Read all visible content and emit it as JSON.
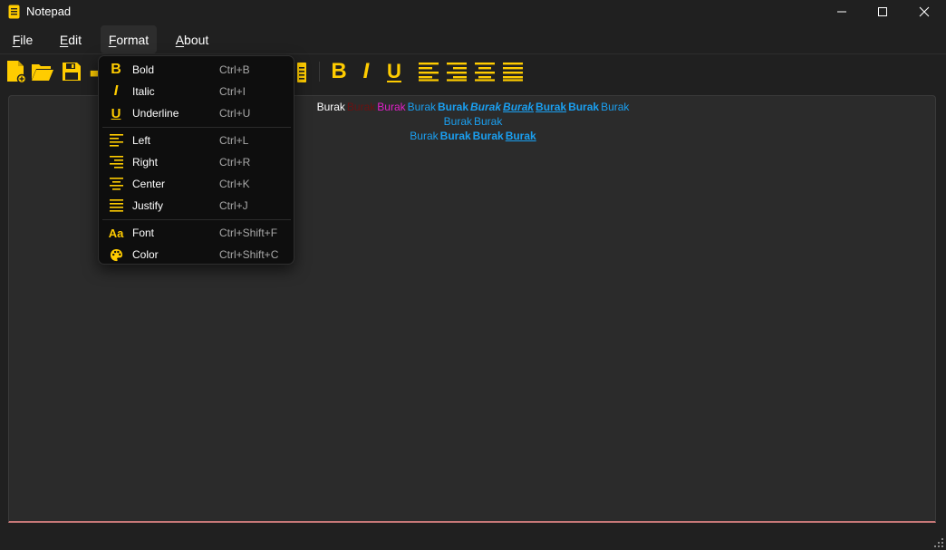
{
  "window": {
    "title": "Notepad"
  },
  "menubar": {
    "file": {
      "mnemonic": "F",
      "rest": "ile"
    },
    "edit": {
      "mnemonic": "E",
      "rest": "dit"
    },
    "format": {
      "mnemonic": "F",
      "rest": "ormat"
    },
    "about": {
      "mnemonic": "A",
      "rest": "bout"
    }
  },
  "colors": {
    "accent": "#ffcc00",
    "text_blue": "#1a9ff0",
    "text_dark_red": "#6b1111",
    "text_magenta": "#e020c8"
  },
  "editor": {
    "line1": [
      "Burak",
      "Burak",
      "Burak",
      "Burak",
      "Burak",
      "Burak",
      "Burak",
      "Burak",
      "Burak",
      "Burak"
    ],
    "line2": [
      "Burak",
      "Burak"
    ],
    "line3": [
      "Burak",
      "Burak",
      "Burak",
      "Burak"
    ]
  },
  "format_menu": {
    "bold": {
      "label": "Bold",
      "shortcut": "Ctrl+B"
    },
    "italic": {
      "label": "Italic",
      "shortcut": "Ctrl+I"
    },
    "underline": {
      "label": "Underline",
      "shortcut": "Ctrl+U"
    },
    "left": {
      "label": "Left",
      "shortcut": "Ctrl+L"
    },
    "right": {
      "label": "Right",
      "shortcut": "Ctrl+R"
    },
    "center": {
      "label": "Center",
      "shortcut": "Ctrl+K"
    },
    "justify": {
      "label": "Justify",
      "shortcut": "Ctrl+J"
    },
    "font": {
      "label": "Font",
      "shortcut": "Ctrl+Shift+F",
      "icon_text": "Aa"
    },
    "color": {
      "label": "Color",
      "shortcut": "Ctrl+Shift+C"
    }
  },
  "toolbar": {
    "bold_glyph": "B",
    "italic_glyph": "I",
    "underline_glyph": "U"
  }
}
